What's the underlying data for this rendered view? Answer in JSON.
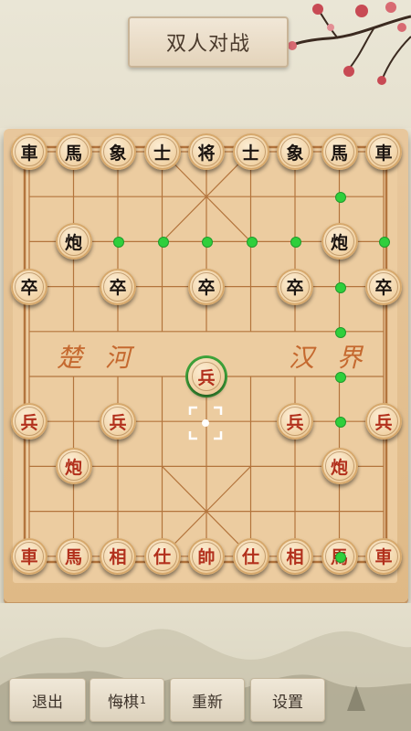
{
  "title": "双人对战",
  "colors": {
    "red_piece": "#b2301c",
    "black_piece": "#1b1410",
    "hint_dot": "#2fcf3c",
    "board": "#e8c79c"
  },
  "board": {
    "river_left": "楚 河",
    "river_right": "汉 界",
    "pieces": [
      {
        "ch": "車",
        "side": "black",
        "col": 0,
        "row": 0
      },
      {
        "ch": "馬",
        "side": "black",
        "col": 1,
        "row": 0
      },
      {
        "ch": "象",
        "side": "black",
        "col": 2,
        "row": 0
      },
      {
        "ch": "士",
        "side": "black",
        "col": 3,
        "row": 0
      },
      {
        "ch": "将",
        "side": "black",
        "col": 4,
        "row": 0
      },
      {
        "ch": "士",
        "side": "black",
        "col": 5,
        "row": 0
      },
      {
        "ch": "象",
        "side": "black",
        "col": 6,
        "row": 0
      },
      {
        "ch": "馬",
        "side": "black",
        "col": 7,
        "row": 0
      },
      {
        "ch": "車",
        "side": "black",
        "col": 8,
        "row": 0
      },
      {
        "ch": "炮",
        "side": "black",
        "col": 1,
        "row": 2
      },
      {
        "ch": "炮",
        "side": "black",
        "col": 7,
        "row": 2
      },
      {
        "ch": "卒",
        "side": "black",
        "col": 0,
        "row": 3
      },
      {
        "ch": "卒",
        "side": "black",
        "col": 2,
        "row": 3
      },
      {
        "ch": "卒",
        "side": "black",
        "col": 4,
        "row": 3
      },
      {
        "ch": "卒",
        "side": "black",
        "col": 6,
        "row": 3
      },
      {
        "ch": "卒",
        "side": "black",
        "col": 8,
        "row": 3
      },
      {
        "ch": "兵",
        "side": "red",
        "col": 4,
        "row": 5,
        "selected": true
      },
      {
        "ch": "兵",
        "side": "red",
        "col": 0,
        "row": 6
      },
      {
        "ch": "兵",
        "side": "red",
        "col": 2,
        "row": 6
      },
      {
        "ch": "兵",
        "side": "red",
        "col": 6,
        "row": 6
      },
      {
        "ch": "兵",
        "side": "red",
        "col": 8,
        "row": 6
      },
      {
        "ch": "炮",
        "side": "red",
        "col": 1,
        "row": 7
      },
      {
        "ch": "炮",
        "side": "red",
        "col": 7,
        "row": 7
      },
      {
        "ch": "車",
        "side": "red",
        "col": 0,
        "row": 9
      },
      {
        "ch": "馬",
        "side": "red",
        "col": 1,
        "row": 9
      },
      {
        "ch": "相",
        "side": "red",
        "col": 2,
        "row": 9
      },
      {
        "ch": "仕",
        "side": "red",
        "col": 3,
        "row": 9
      },
      {
        "ch": "帥",
        "side": "red",
        "col": 4,
        "row": 9
      },
      {
        "ch": "仕",
        "side": "red",
        "col": 5,
        "row": 9
      },
      {
        "ch": "相",
        "side": "red",
        "col": 6,
        "row": 9
      },
      {
        "ch": "馬",
        "side": "red",
        "col": 7,
        "row": 9
      },
      {
        "ch": "車",
        "side": "red",
        "col": 8,
        "row": 9
      }
    ],
    "hints": [
      {
        "col": 7,
        "row": 1
      },
      {
        "col": 2,
        "row": 2
      },
      {
        "col": 3,
        "row": 2
      },
      {
        "col": 4,
        "row": 2
      },
      {
        "col": 5,
        "row": 2
      },
      {
        "col": 6,
        "row": 2
      },
      {
        "col": 8,
        "row": 2
      },
      {
        "col": 7,
        "row": 3
      },
      {
        "col": 7,
        "row": 4
      },
      {
        "col": 7,
        "row": 5
      },
      {
        "col": 7,
        "row": 6
      },
      {
        "col": 7,
        "row": 9
      }
    ]
  },
  "toolbar": {
    "exit_label": "退出",
    "undo_label": "悔棋",
    "undo_count": "1",
    "restart_label": "重新",
    "settings_label": "设置"
  }
}
